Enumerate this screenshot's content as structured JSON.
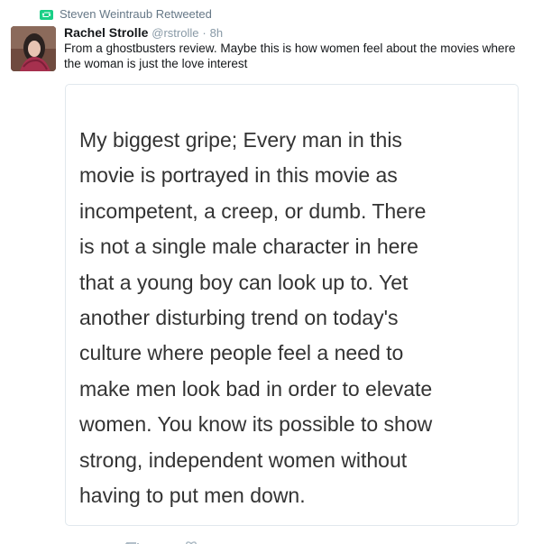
{
  "context": {
    "retweeted_by": "Steven Weintraub Retweeted",
    "retweet_icon": "retweet-icon",
    "color": "#19cf86"
  },
  "tweet": {
    "author_name": "Rachel Strolle",
    "username": "@rstrolle",
    "separator": "·",
    "timestamp": "8h",
    "text": "From a ghostbusters review. Maybe this is how women feel about the movies where the woman is just the love interest",
    "avatar": "avatar-photo"
  },
  "quote": {
    "text": "My biggest gripe; Every man in this\nmovie is portrayed in this movie as\nincompetent, a creep, or dumb. There\nis not a single male character in here\nthat a young boy can look up to. Yet\nanother disturbing trend on today's\nculture where people feel a need to\nmake men look bad in order to elevate\nwomen. You know its possible to show\nstrong, independent women without\nhaving to put men down."
  },
  "actions": {
    "icons": [
      "reply-icon",
      "retweet-action-icon",
      "like-icon"
    ]
  }
}
